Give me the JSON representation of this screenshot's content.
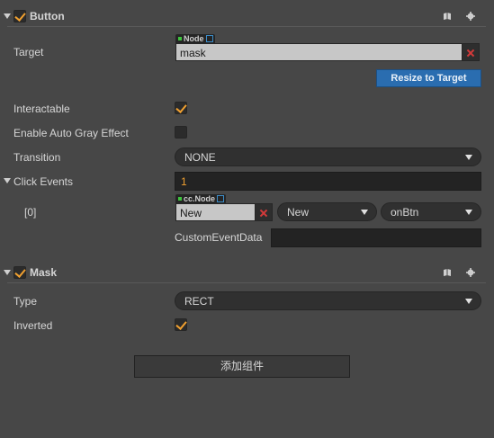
{
  "button_component": {
    "title": "Button",
    "enabled": true,
    "target": {
      "label": "Target",
      "type_tag": "Node",
      "value": "mask"
    },
    "resize_button": "Resize to Target",
    "interactable": {
      "label": "Interactable",
      "checked": true
    },
    "auto_gray": {
      "label": "Enable Auto Gray Effect",
      "checked": false
    },
    "transition": {
      "label": "Transition",
      "value": "NONE"
    },
    "click_events": {
      "label": "Click Events",
      "count": "1",
      "items": [
        {
          "index": "[0]",
          "type_tag": "cc.Node",
          "node": "New",
          "component": "New",
          "handler": "onBtn",
          "custom_data_label": "CustomEventData",
          "custom_data_value": ""
        }
      ]
    }
  },
  "mask_component": {
    "title": "Mask",
    "enabled": true,
    "type": {
      "label": "Type",
      "value": "RECT"
    },
    "inverted": {
      "label": "Inverted",
      "checked": true
    }
  },
  "add_component_button": "添加组件",
  "icons": {
    "book": "book-icon",
    "settings": "gear-icon",
    "collapse": "triangle-down-icon",
    "clear": "close-icon",
    "external": "external-link-icon"
  },
  "colors": {
    "background": "#474747",
    "accent_orange": "#f0a030",
    "primary_button": "#2a6db0",
    "clear_red": "#d43a3a",
    "node_green": "#3ec43e"
  }
}
